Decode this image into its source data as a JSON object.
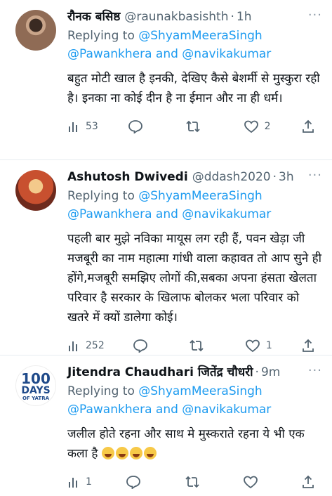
{
  "tweets": [
    {
      "name": "रौनक बसिष्ठ",
      "handle": "@raunakbasishth",
      "dot": "·",
      "time": "1h",
      "more": "···",
      "reply_prefix": "Replying to",
      "mention1": "@ShyamMeeraSingh",
      "mention2": "@Pawankhera",
      "and": "and",
      "mention3": "@navikakumar",
      "text": "बहुत मोटी खाल है इनकी, देखिए कैसे बेशर्मी से मुस्कुरा रही है। इनका ना कोई दीन है ना ईमान और ना ही धर्म।",
      "views": "53",
      "replies": "",
      "retweets": "",
      "likes": "2"
    },
    {
      "name": "Ashutosh Dwivedi",
      "handle": "@ddash2020",
      "dot": "·",
      "time": "3h",
      "more": "···",
      "reply_prefix": "Replying to",
      "mention1": "@ShyamMeeraSingh",
      "mention2": "@Pawankhera",
      "and": "and",
      "mention3": "@navikakumar",
      "text": "पहली बार मुझे नविका मायूस लग रही हैं, पवन खेड़ा जी मजबूरी का नाम महात्मा गांधी वाला कहावत तो आप सुने ही होंगे,मजबूरी समझिए लोगों की,सबका अपना हंसता खेलता परिवार है सरकार के खिलाफ बोलकर भला परिवार को खतरे में क्यों डालेगा कोई।",
      "views": "252",
      "replies": "",
      "retweets": "",
      "likes": "1"
    },
    {
      "name": "Jitendra Chaudhari जितेंद्र चौधरी",
      "handle": "",
      "dot": "·",
      "time": "9m",
      "more": "···",
      "reply_prefix": "Replying to",
      "mention1": "@ShyamMeeraSingh",
      "mention2": "@Pawankhera",
      "and": "and",
      "mention3": "@navikakumar",
      "text": "जलील होते रहना और साथ मे मुस्कराते रहना ये भी एक कला है",
      "views": "1",
      "replies": "",
      "retweets": "",
      "likes": "",
      "avatar_text": {
        "big": "100",
        "days": "DAYS",
        "small": "OF YATRA"
      }
    }
  ],
  "colors": {
    "link": "#1d9bf0",
    "muted": "#536471"
  }
}
